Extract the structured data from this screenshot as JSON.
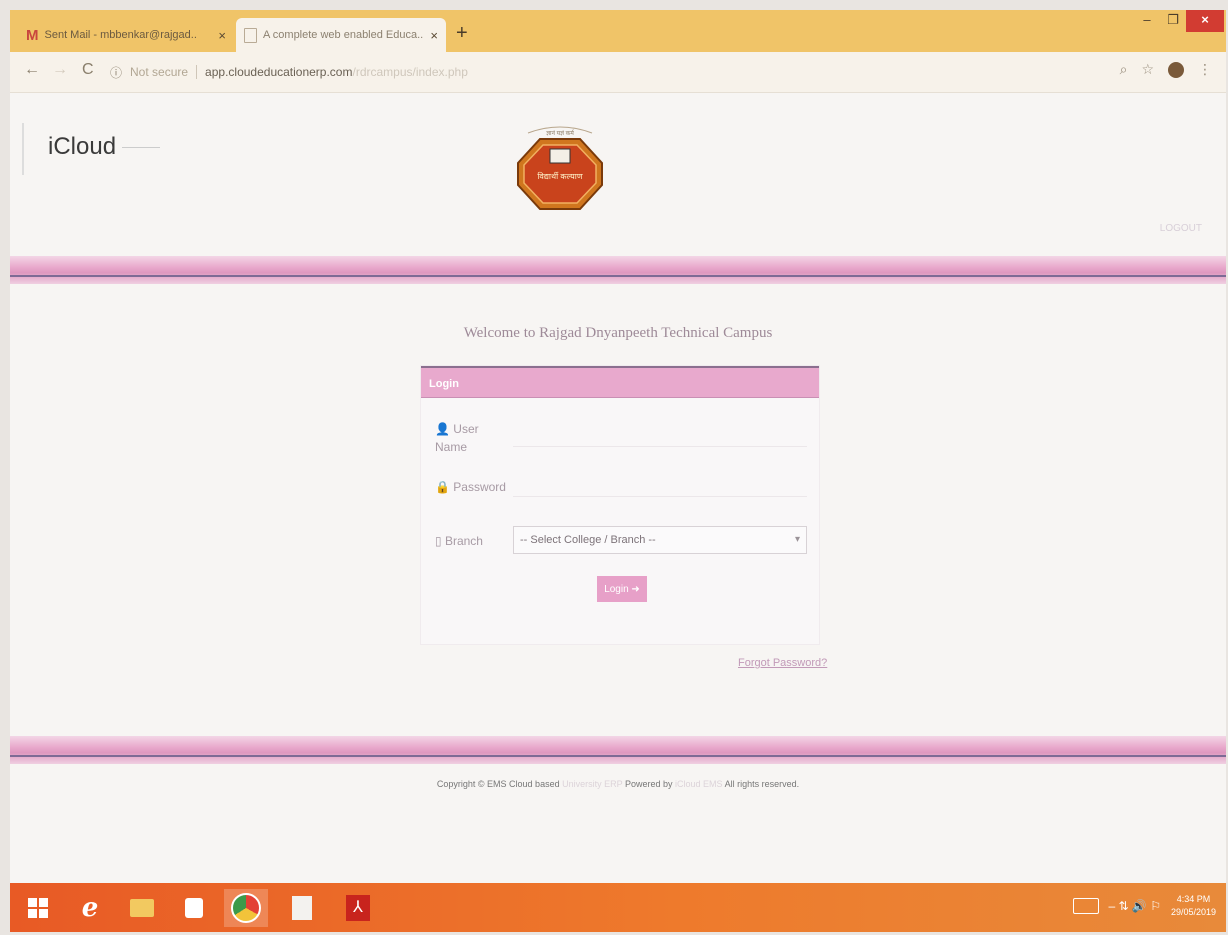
{
  "browser": {
    "tabs": [
      {
        "title": "Sent Mail - mbbenkar@rajgad..",
        "icon": "gmail-icon",
        "close": "×"
      },
      {
        "title": "A complete web enabled Educa..",
        "icon": "page-icon",
        "close": "×"
      }
    ],
    "new_tab": "+",
    "window_controls": {
      "minimize": "–",
      "restore": "❐",
      "close": "×"
    },
    "nav": {
      "back": "←",
      "forward": "→",
      "reload": "C"
    },
    "address": {
      "info_icon": "ⓘ",
      "security": "Not secure",
      "domain": "app.cloudeducationerp.com",
      "path": "/rdrcampus/index.php"
    },
    "right_icons": {
      "zoom": "⌕",
      "star": "☆",
      "menu": "⋮"
    }
  },
  "header": {
    "brand": "iCloud",
    "logout": "LOGOUT",
    "logo_text_top": "ज्ञानं यज्ञं कर्म",
    "logo_text_main": "विद्यार्थी कल्याण"
  },
  "login": {
    "welcome": "Welcome to Rajgad Dnyanpeeth Technical Campus",
    "panel_title": "Login",
    "user_label_line1": "👤 User",
    "user_label_line2": "Name",
    "password_label": "🔒 Password",
    "branch_label": "▯ Branch",
    "branch_placeholder": "-- Select College / Branch --",
    "submit": "Login ➜",
    "forgot": "Forgot Password?"
  },
  "footer": {
    "part1": "Copyright © EMS Cloud based",
    "faint1": "University ERP",
    "part2": "Powered by",
    "faint2": "iCloud EMS",
    "part3": "All rights reserved."
  },
  "taskbar": {
    "clock_time": "4:34 PM",
    "clock_date": "29/05/2019",
    "tray_text": "–  ⇅ 🔊 ⚐"
  }
}
